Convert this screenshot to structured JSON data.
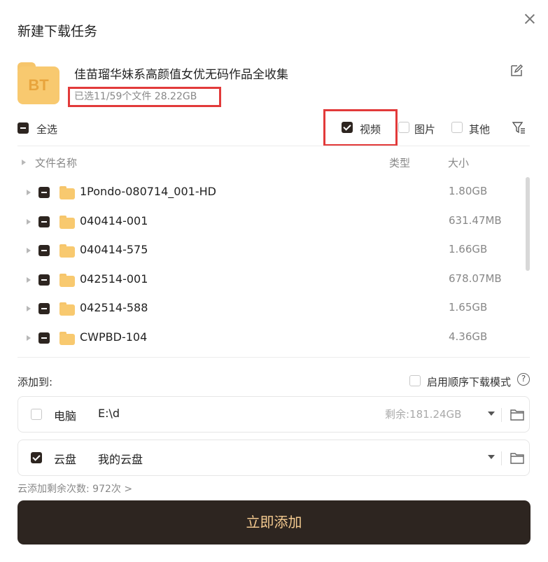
{
  "dialog": {
    "title": "新建下载任务"
  },
  "task": {
    "icon_text": "BT",
    "name": "佳苗瑠华妹系高颜值女优无码作品全收集",
    "selected_info": "已选11/59个文件 28.22GB"
  },
  "filters": {
    "select_all": "全选",
    "video": "视频",
    "image": "图片",
    "other": "其他",
    "video_checked": true,
    "image_checked": false,
    "other_checked": false
  },
  "table": {
    "headers": {
      "name": "文件名称",
      "type": "类型",
      "size": "大小"
    },
    "rows": [
      {
        "name": "1Pondo-080714_001-HD",
        "type": "",
        "size": "1.80GB"
      },
      {
        "name": "040414-001",
        "type": "",
        "size": "631.47MB"
      },
      {
        "name": "040414-575",
        "type": "",
        "size": "1.66GB"
      },
      {
        "name": "042514-001",
        "type": "",
        "size": "678.07MB"
      },
      {
        "name": "042514-588",
        "type": "",
        "size": "1.65GB"
      },
      {
        "name": "CWPBD-104",
        "type": "",
        "size": "4.36GB"
      }
    ]
  },
  "destination": {
    "add_to_label": "添加到:",
    "sequential_label": "启用顺序下载模式",
    "pc": {
      "label": "电脑",
      "path": "E:\\d",
      "free": "剩余:181.24GB",
      "checked": false
    },
    "cloud": {
      "label": "云盘",
      "path": "我的云盘",
      "checked": true
    },
    "cloud_remaining": "云添加剩余次数: 972次 >"
  },
  "actions": {
    "add_now": "立即添加"
  },
  "colors": {
    "accent_dark": "#2d2520",
    "button_text": "#f3c98f",
    "highlight_box": "#e23a3a",
    "folder": "#f8c96f"
  }
}
